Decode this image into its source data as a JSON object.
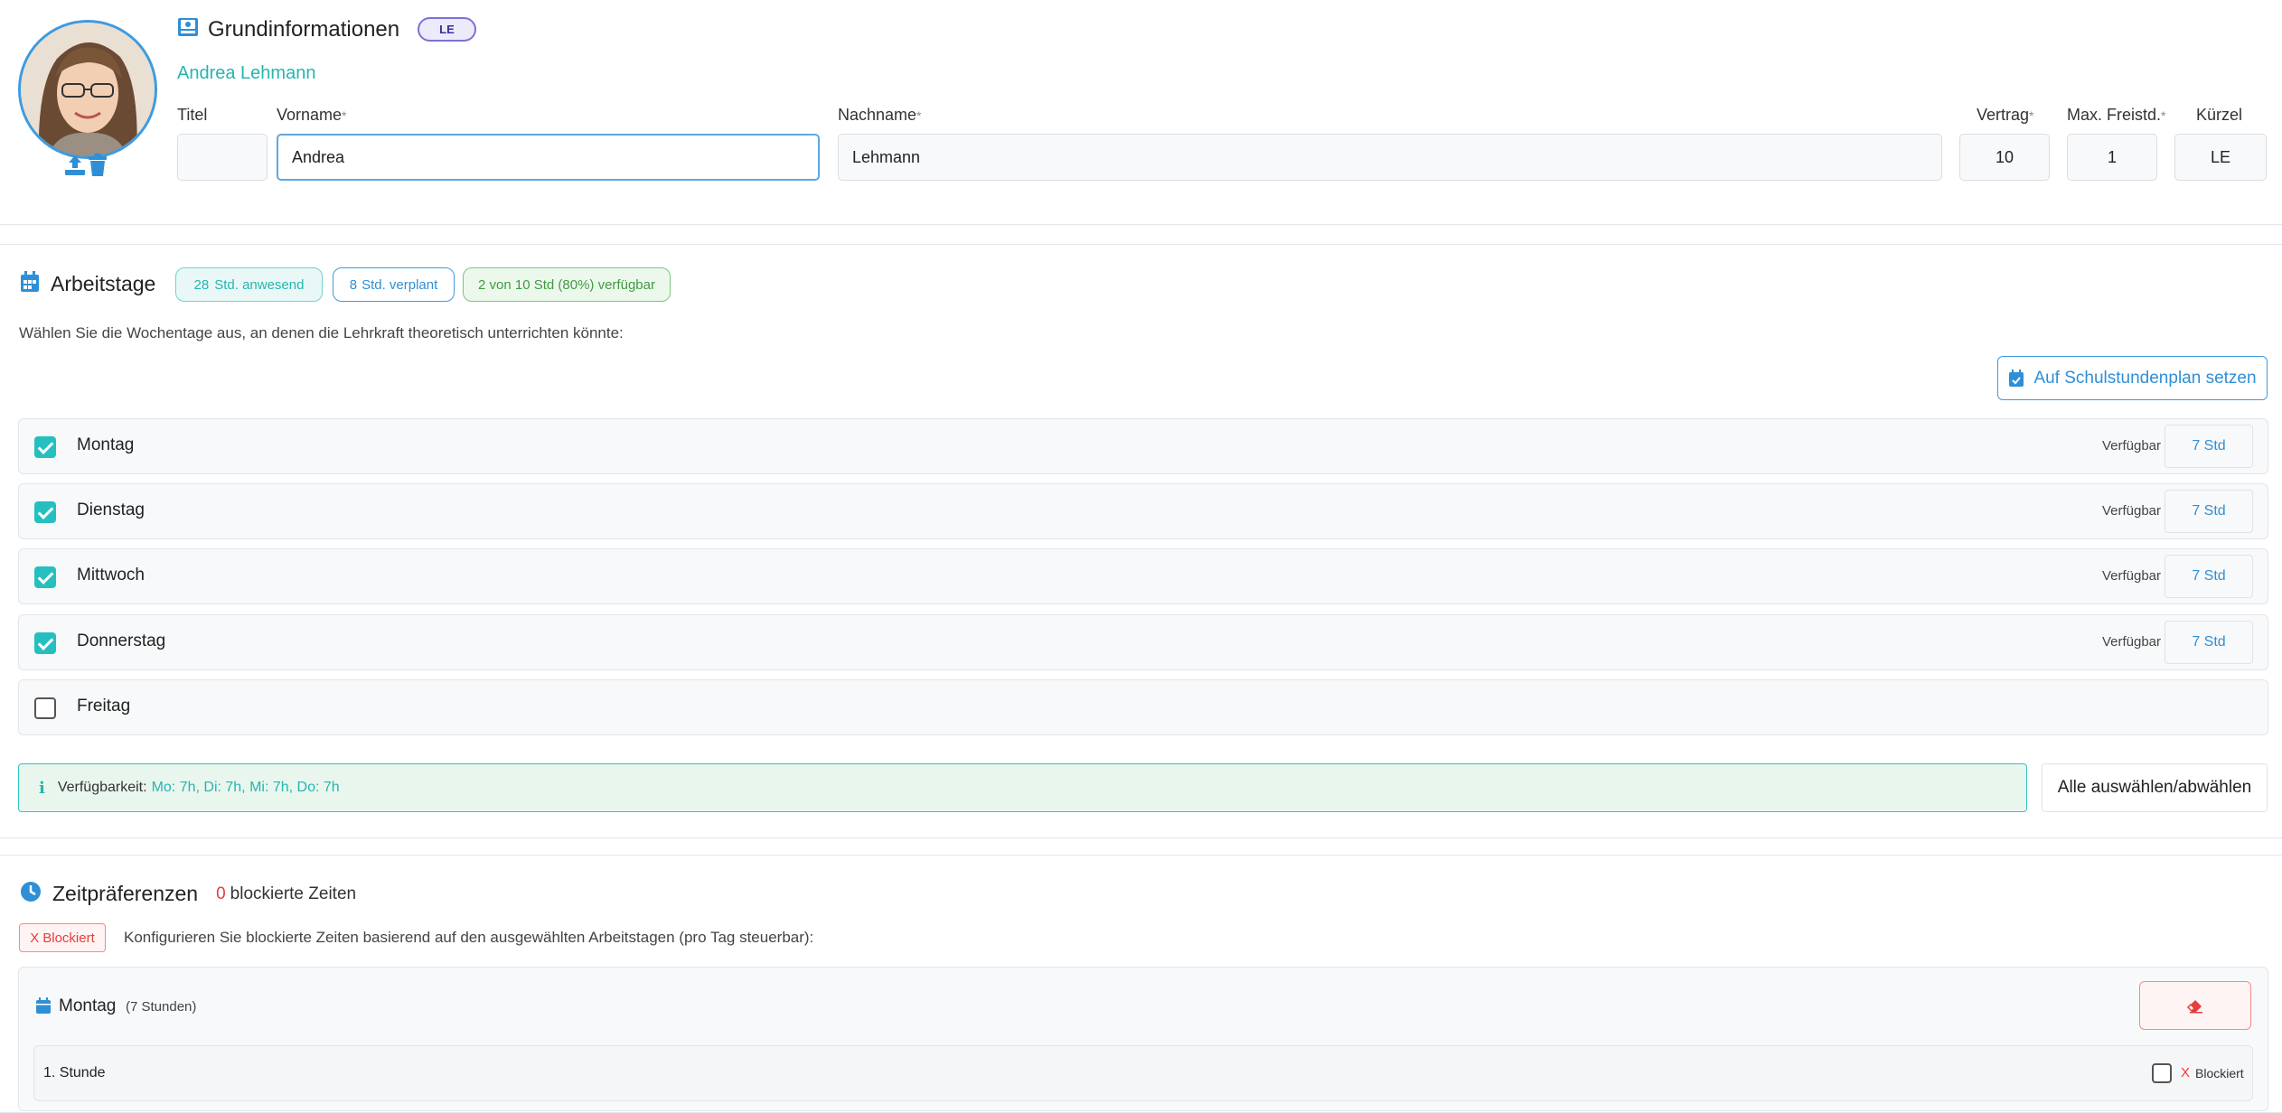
{
  "grundinfo": {
    "title": "Grundinformationen",
    "badge": "LE",
    "full_name": "Andrea Lehmann",
    "fields": {
      "titel": {
        "label": "Titel",
        "value": ""
      },
      "vorname": {
        "label": "Vorname",
        "value": "Andrea"
      },
      "nachname": {
        "label": "Nachname",
        "value": "Lehmann"
      },
      "vertrag": {
        "label": "Vertrag",
        "value": "10"
      },
      "max_freistd": {
        "label": "Max. Freistd.",
        "value": "1"
      },
      "kuerzel": {
        "label": "Kürzel",
        "value": "LE"
      }
    },
    "required_mark": "*"
  },
  "arbeitstage": {
    "title": "Arbeitstage",
    "pills": {
      "anwesend_num": "28",
      "anwesend_text": "Std. anwesend",
      "verplant_num": "8",
      "verplant_text": "Std. verplant",
      "verfuegbar": "2 von 10 Std (80%) verfügbar"
    },
    "description": "Wählen Sie die Wochentage aus, an denen die Lehrkraft theoretisch unterrichten könnte:",
    "set_button": "Auf Schulstundenplan setzen",
    "avail_label": "Verfügbar",
    "days": [
      {
        "name": "Montag",
        "checked": true,
        "hours": "7 Std"
      },
      {
        "name": "Dienstag",
        "checked": true,
        "hours": "7 Std"
      },
      {
        "name": "Mittwoch",
        "checked": true,
        "hours": "7 Std"
      },
      {
        "name": "Donnerstag",
        "checked": true,
        "hours": "7 Std"
      },
      {
        "name": "Freitag",
        "checked": false,
        "hours": ""
      }
    ],
    "info_label": "Verfügbarkeit:",
    "info_value": "Mo: 7h, Di: 7h, Mi: 7h, Do: 7h",
    "select_all_button": "Alle auswählen/abwählen"
  },
  "zeitpraeferenzen": {
    "title": "Zeitpräferenzen",
    "blocked_count": "0",
    "blocked_text": "blockierte Zeiten",
    "legend_tag": "Blockiert",
    "legend_mark": "X",
    "description": "Konfigurieren Sie blockierte Zeiten basierend auf den ausgewählten Arbeitstagen (pro Tag steuerbar):",
    "day": {
      "name": "Montag",
      "count": "(7 Stunden)"
    },
    "slots": [
      {
        "label": "1. Stunde",
        "blocked_label": "Blockiert",
        "mark": "X",
        "checked": false
      }
    ]
  },
  "colors": {
    "teal": "#26bfc0",
    "blue": "#2f8fd6",
    "red": "#e53e3e",
    "green": "#4caf50",
    "purple": "#7d6fd6"
  }
}
